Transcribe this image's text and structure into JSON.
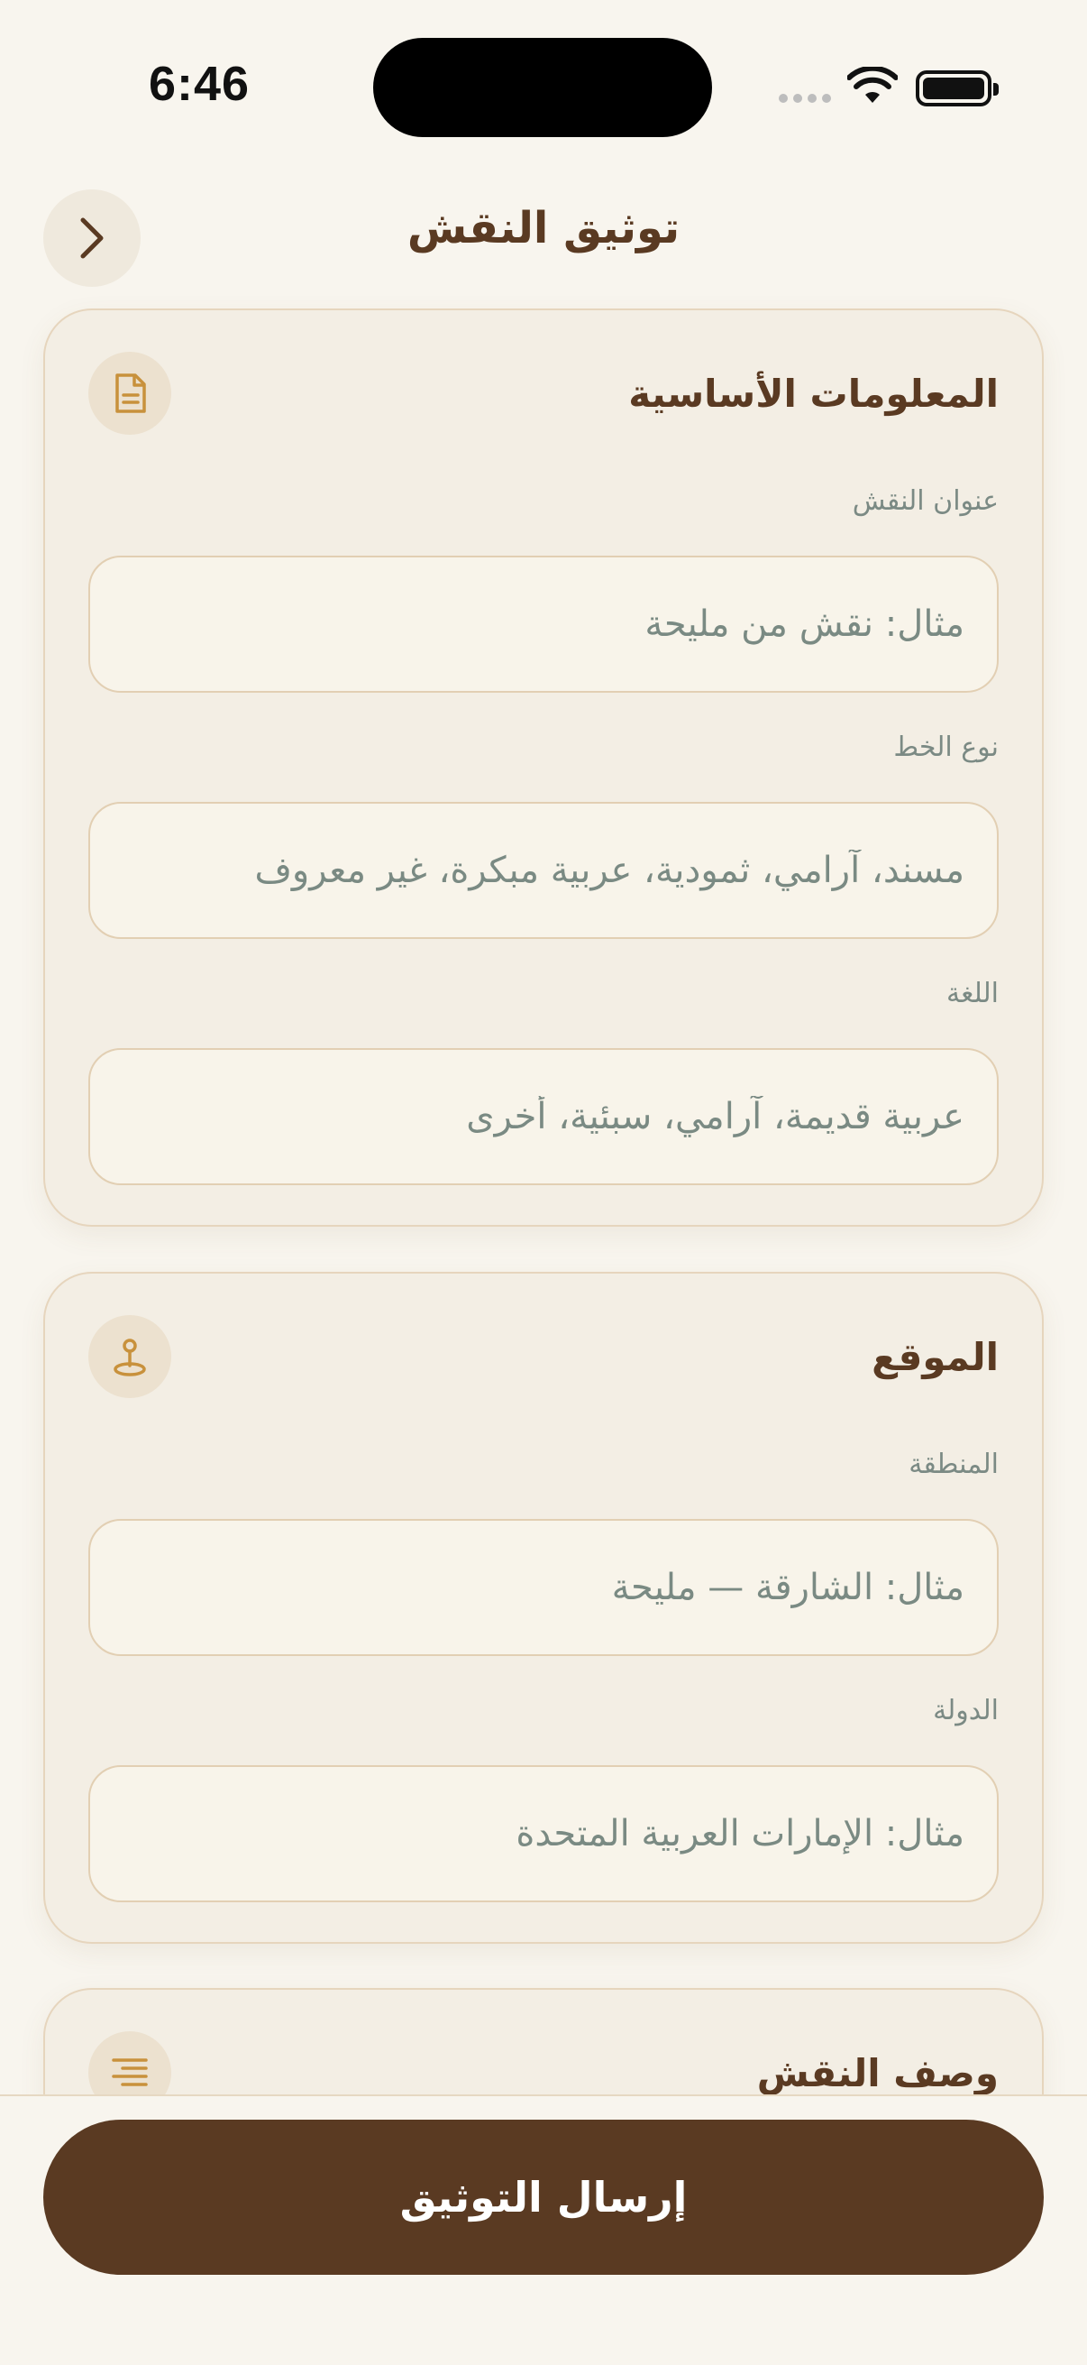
{
  "status_bar": {
    "time": "6:46"
  },
  "header": {
    "title": "توثيق النقش",
    "back_icon": "chevron-right-icon"
  },
  "sections": {
    "basic": {
      "title": "المعلومات الأساسية",
      "icon": "document-icon",
      "fields": [
        {
          "label": "عنوان النقش",
          "placeholder": "مثال: نقش من مليحة",
          "value": ""
        },
        {
          "label": "نوع الخط",
          "placeholder": "مسند، آرامي، ثمودية، عربية مبكرة، غير معروف",
          "value": ""
        },
        {
          "label": "اللغة",
          "placeholder": "عربية قديمة، آرامي، سبئية، أخرى",
          "value": ""
        }
      ]
    },
    "location": {
      "title": "الموقع",
      "icon": "map-pin-icon",
      "fields": [
        {
          "label": "المنطقة",
          "placeholder": "مثال: الشارقة — مليحة",
          "value": ""
        },
        {
          "label": "الدولة",
          "placeholder": "مثال: الإمارات العربية المتحدة",
          "value": ""
        }
      ]
    },
    "description": {
      "title": "وصف النقش",
      "icon": "text-align-icon"
    }
  },
  "footer": {
    "submit_label": "إرسال التوثيق"
  },
  "colors": {
    "background": "#f8f5ee",
    "card": "#f3eee4",
    "accent": "#c8913c",
    "primary": "#5a3a22",
    "placeholder": "#7a8a83"
  }
}
